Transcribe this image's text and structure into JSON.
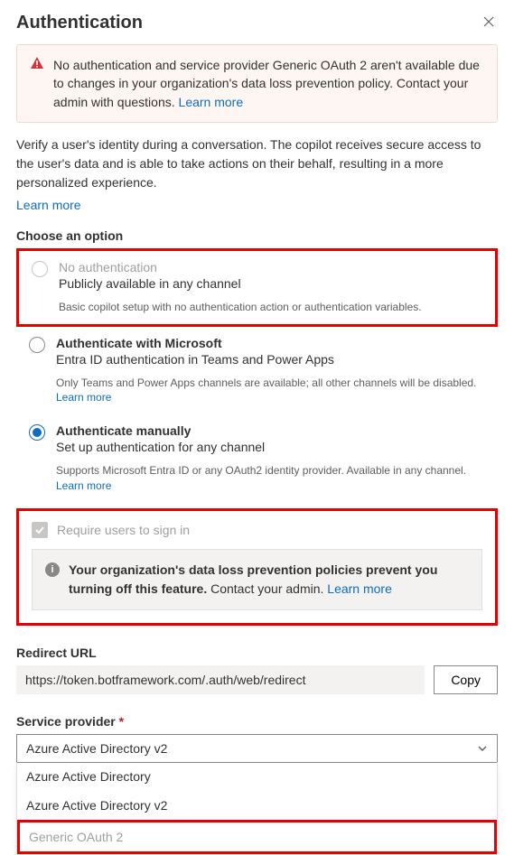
{
  "header": {
    "title": "Authentication"
  },
  "banner": {
    "text_a": "No authentication and service provider Generic OAuth 2 aren't available due to changes in your organization's data loss prevention policy. Contact your admin with questions. ",
    "learn": "Learn more"
  },
  "intro": {
    "text": "Verify a user's identity during a conversation. The copilot receives secure access to the user's data and is able to take actions on their behalf, resulting in a more personalized experience.",
    "learn": "Learn more"
  },
  "choose_label": "Choose an option",
  "options": {
    "none": {
      "title": "No authentication",
      "sub": "Publicly available in any channel",
      "fine": "Basic copilot setup with no authentication action or authentication variables."
    },
    "ms": {
      "title": "Authenticate with Microsoft",
      "sub": "Entra ID authentication in Teams and Power Apps",
      "fine": "Only Teams and Power Apps channels are available; all other channels will be disabled. ",
      "learn": "Learn more"
    },
    "manual": {
      "title": "Authenticate manually",
      "sub": "Set up authentication for any channel",
      "fine": "Supports Microsoft Entra ID or any OAuth2 identity provider. Available in any channel. ",
      "learn": "Learn more"
    }
  },
  "signin": {
    "label": "Require users to sign in",
    "dlp_strong": "Your organization's data loss prevention policies prevent you turning off this feature.",
    "dlp_rest": " Contact your admin. ",
    "learn": "Learn more"
  },
  "redirect": {
    "label": "Redirect URL",
    "value": "https://token.botframework.com/.auth/web/redirect",
    "copy": "Copy"
  },
  "provider": {
    "label": "Service provider",
    "selected": "Azure Active Directory v2",
    "options": [
      "Azure Active Directory",
      "Azure Active Directory v2",
      "Generic OAuth 2"
    ]
  }
}
